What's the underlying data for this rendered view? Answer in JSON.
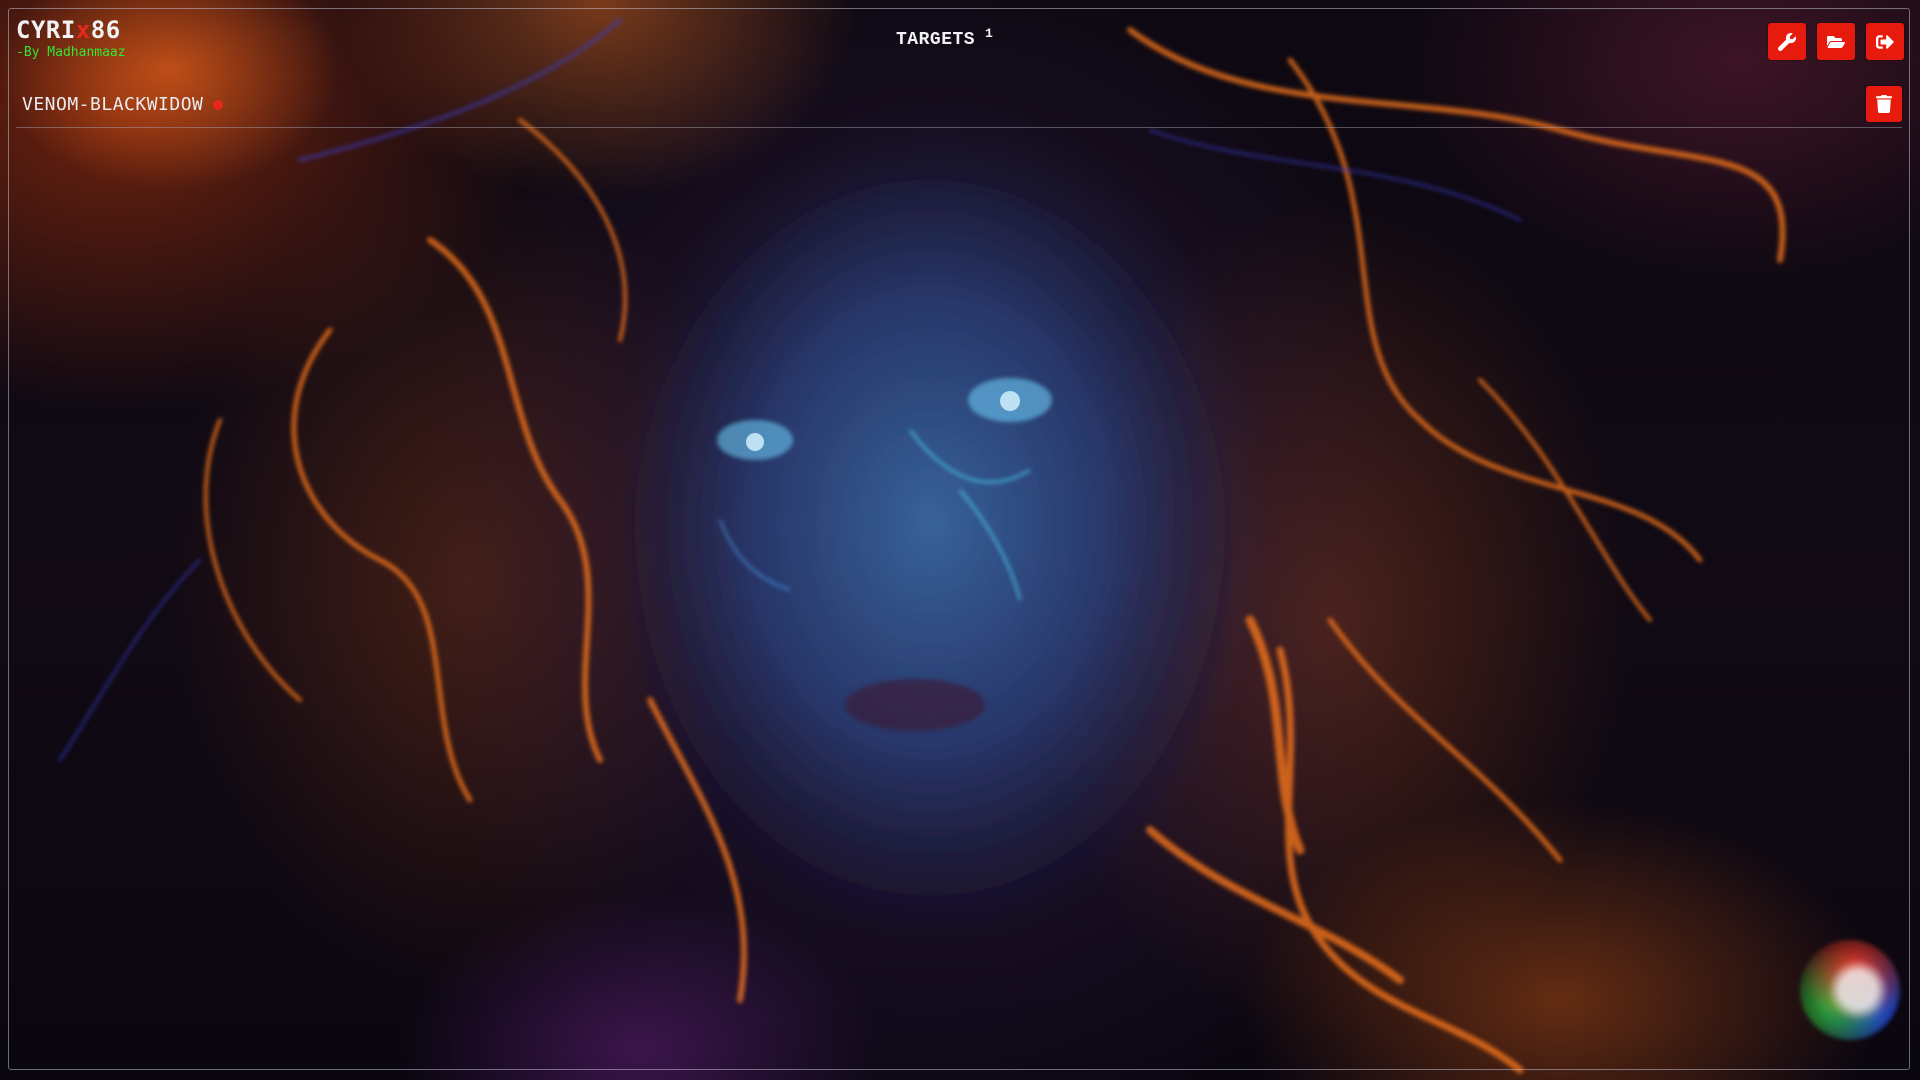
{
  "brand": {
    "logo_prefix": "CYRI",
    "logo_x": "x",
    "logo_suffix": "86",
    "byline": "-By Madhanmaaz"
  },
  "header": {
    "title": "TARGETS",
    "count": "1",
    "actions": [
      {
        "name": "settings-button",
        "icon": "wrench-icon"
      },
      {
        "name": "open-folder-button",
        "icon": "folder-open-icon"
      },
      {
        "name": "logout-button",
        "icon": "logout-icon"
      }
    ]
  },
  "targets": [
    {
      "name": "VENOM-BLACKWIDOW",
      "status": "offline",
      "status_color": "#e8281c"
    }
  ],
  "colors": {
    "accent": "#e61b0e",
    "brand_x": "#e8281c",
    "byline": "#32e632"
  }
}
